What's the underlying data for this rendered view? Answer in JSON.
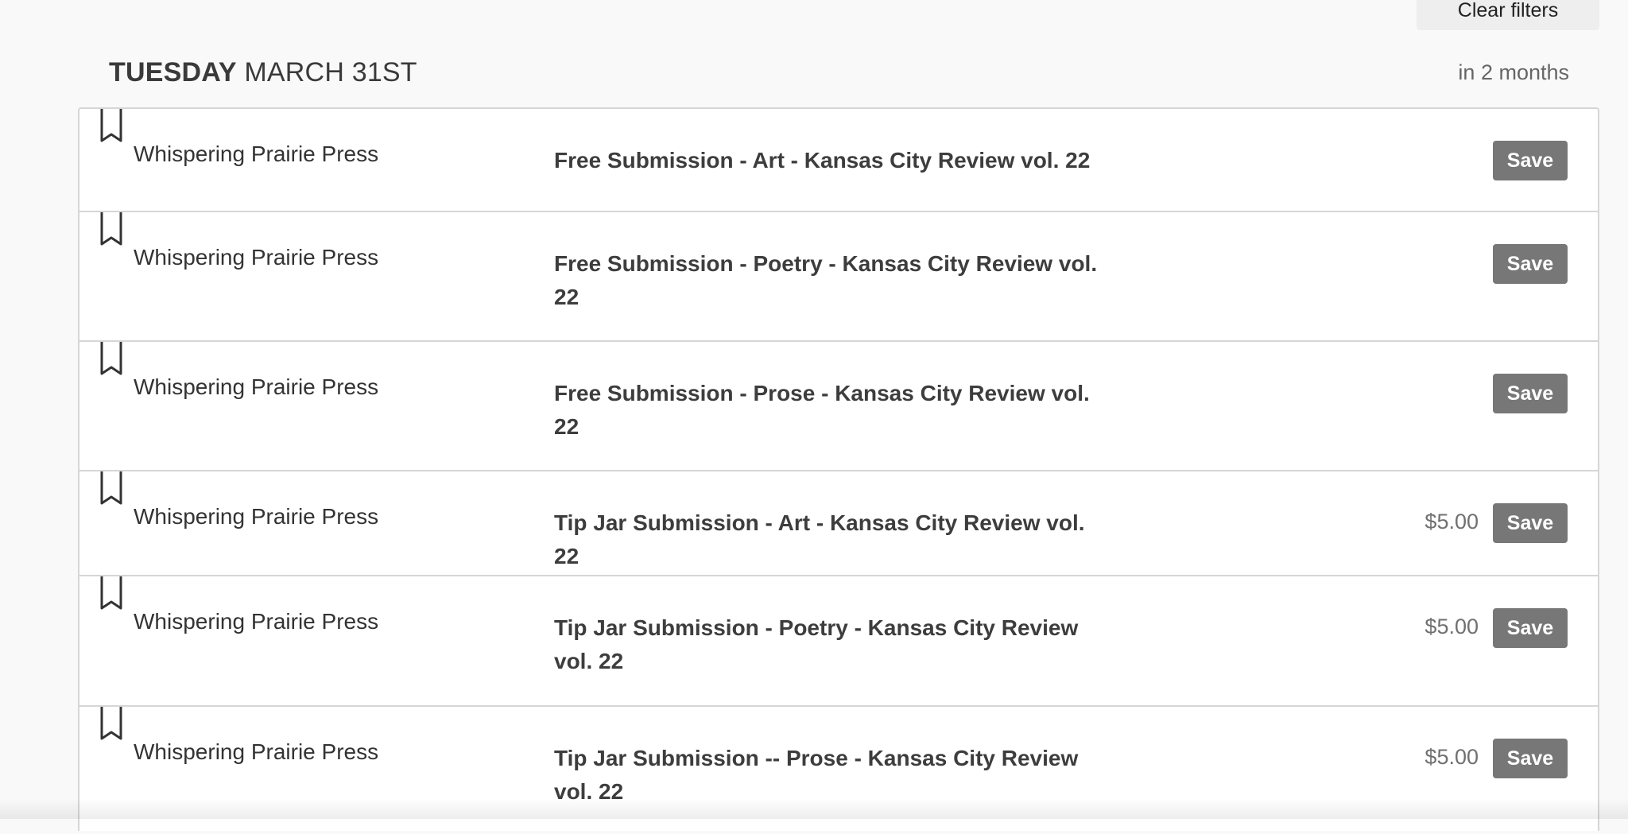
{
  "filters": {
    "clear_label": "Clear filters"
  },
  "day_group": {
    "weekday": "TUESDAY",
    "date": "MARCH 31ST",
    "relative": "in 2 months"
  },
  "rows": [
    {
      "publisher": "Whispering Prairie Press",
      "title": "Free Submission - Art - Kansas City Review vol. 22",
      "price": "",
      "save_label": "Save"
    },
    {
      "publisher": "Whispering Prairie Press",
      "title": "Free Submission - Poetry - Kansas City Review vol. 22",
      "price": "",
      "save_label": "Save"
    },
    {
      "publisher": "Whispering Prairie Press",
      "title": "Free Submission - Prose - Kansas City Review vol. 22",
      "price": "",
      "save_label": "Save"
    },
    {
      "publisher": "Whispering Prairie Press",
      "title": "Tip Jar Submission - Art - Kansas City Review vol. 22",
      "price": "$5.00",
      "save_label": "Save"
    },
    {
      "publisher": "Whispering Prairie Press",
      "title": "Tip Jar Submission - Poetry - Kansas City Review vol. 22",
      "price": "$5.00",
      "save_label": "Save"
    },
    {
      "publisher": "Whispering Prairie Press",
      "title": "Tip Jar Submission -- Prose - Kansas City Review vol. 22",
      "price": "$5.00",
      "save_label": "Save"
    }
  ],
  "icons": {
    "bookmark": "bookmark-icon"
  }
}
